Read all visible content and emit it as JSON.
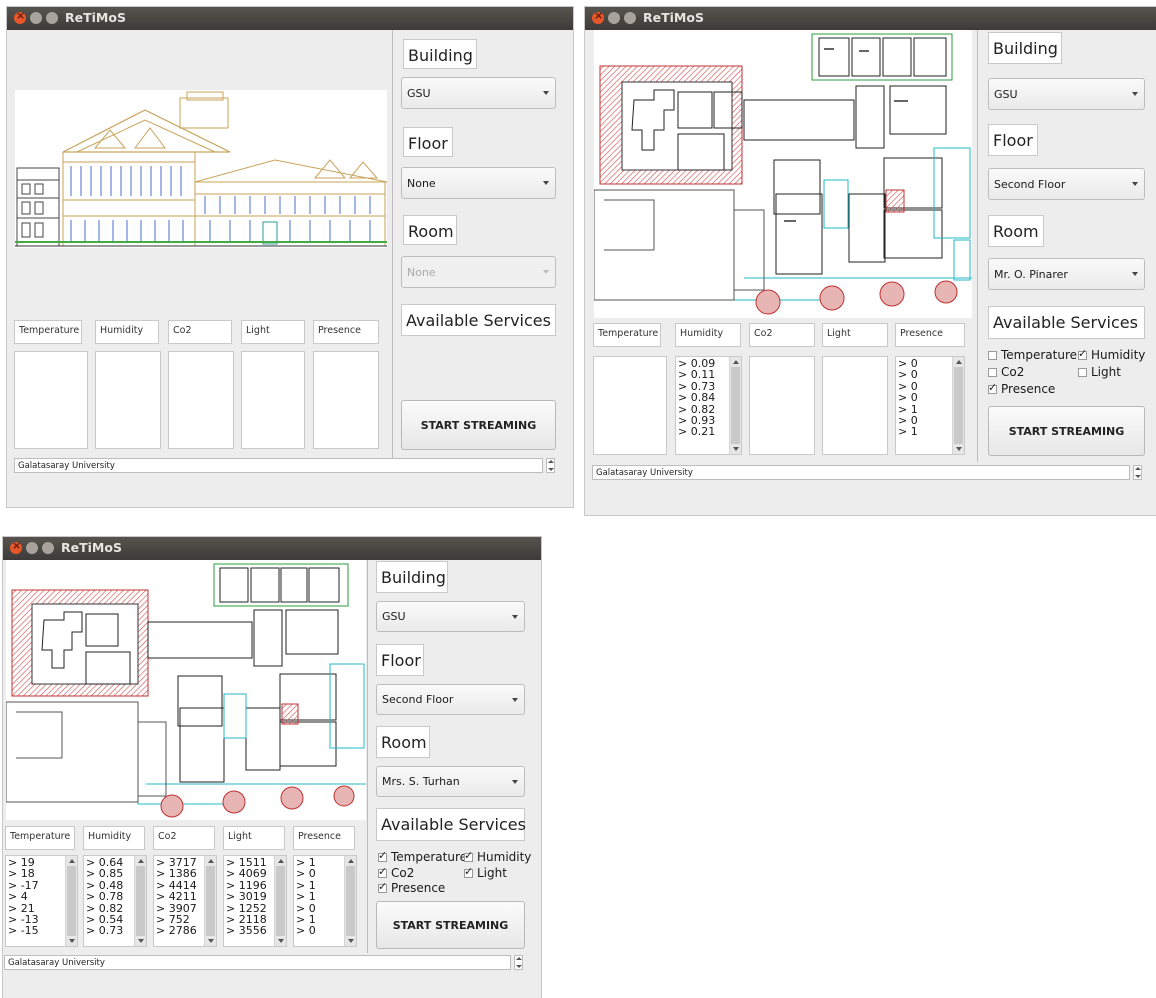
{
  "app": {
    "title": "ReTiMoS",
    "status": "Galatasaray University",
    "start_label": "START STREAMING",
    "labels": {
      "building": "Building",
      "floor": "Floor",
      "room": "Room",
      "services": "Available Services"
    },
    "headers": [
      "Temperature",
      "Humidity",
      "Co2",
      "Light",
      "Presence"
    ]
  },
  "window1": {
    "building": "GSU",
    "floor": "None",
    "room": "None",
    "room_enabled": false
  },
  "window2": {
    "building": "GSU",
    "floor": "Second Floor",
    "room": "Mr. O. Pinarer",
    "services": [
      {
        "label": "Temperature",
        "checked": false
      },
      {
        "label": "Humidity",
        "checked": true
      },
      {
        "label": "Co2",
        "checked": false
      },
      {
        "label": "Light",
        "checked": false
      },
      {
        "label": "Presence",
        "checked": true
      }
    ],
    "values": {
      "humidity": [
        "> 0.09",
        "> 0.11",
        "> 0.73",
        "> 0.84",
        "> 0.82",
        "> 0.93",
        "> 0.21"
      ],
      "presence": [
        "> 0",
        "> 0",
        "> 0",
        "> 0",
        "> 1",
        "> 0",
        "> 1"
      ]
    }
  },
  "window3": {
    "building": "GSU",
    "floor": "Second Floor",
    "room": "Mrs. S. Turhan",
    "services": [
      {
        "label": "Temperature",
        "checked": true
      },
      {
        "label": "Humidity",
        "checked": true
      },
      {
        "label": "Co2",
        "checked": true
      },
      {
        "label": "Light",
        "checked": true
      },
      {
        "label": "Presence",
        "checked": true
      }
    ],
    "values": {
      "temperature": [
        "> 19",
        "> 18",
        "> -17",
        "> 4",
        "> 21",
        "> -13",
        "> -15"
      ],
      "humidity": [
        "> 0.64",
        "> 0.85",
        "> 0.48",
        "> 0.78",
        "> 0.82",
        "> 0.54",
        "> 0.73"
      ],
      "co2": [
        "> 3717",
        "> 1386",
        "> 4414",
        "> 4211",
        "> 3907",
        "> 752",
        "> 2786"
      ],
      "light": [
        "> 1511",
        "> 4069",
        "> 1196",
        "> 3019",
        "> 1252",
        "> 2118",
        "> 3556"
      ],
      "presence": [
        "> 1",
        "> 0",
        "> 1",
        "> 1",
        "> 0",
        "> 1",
        "> 0"
      ]
    }
  }
}
